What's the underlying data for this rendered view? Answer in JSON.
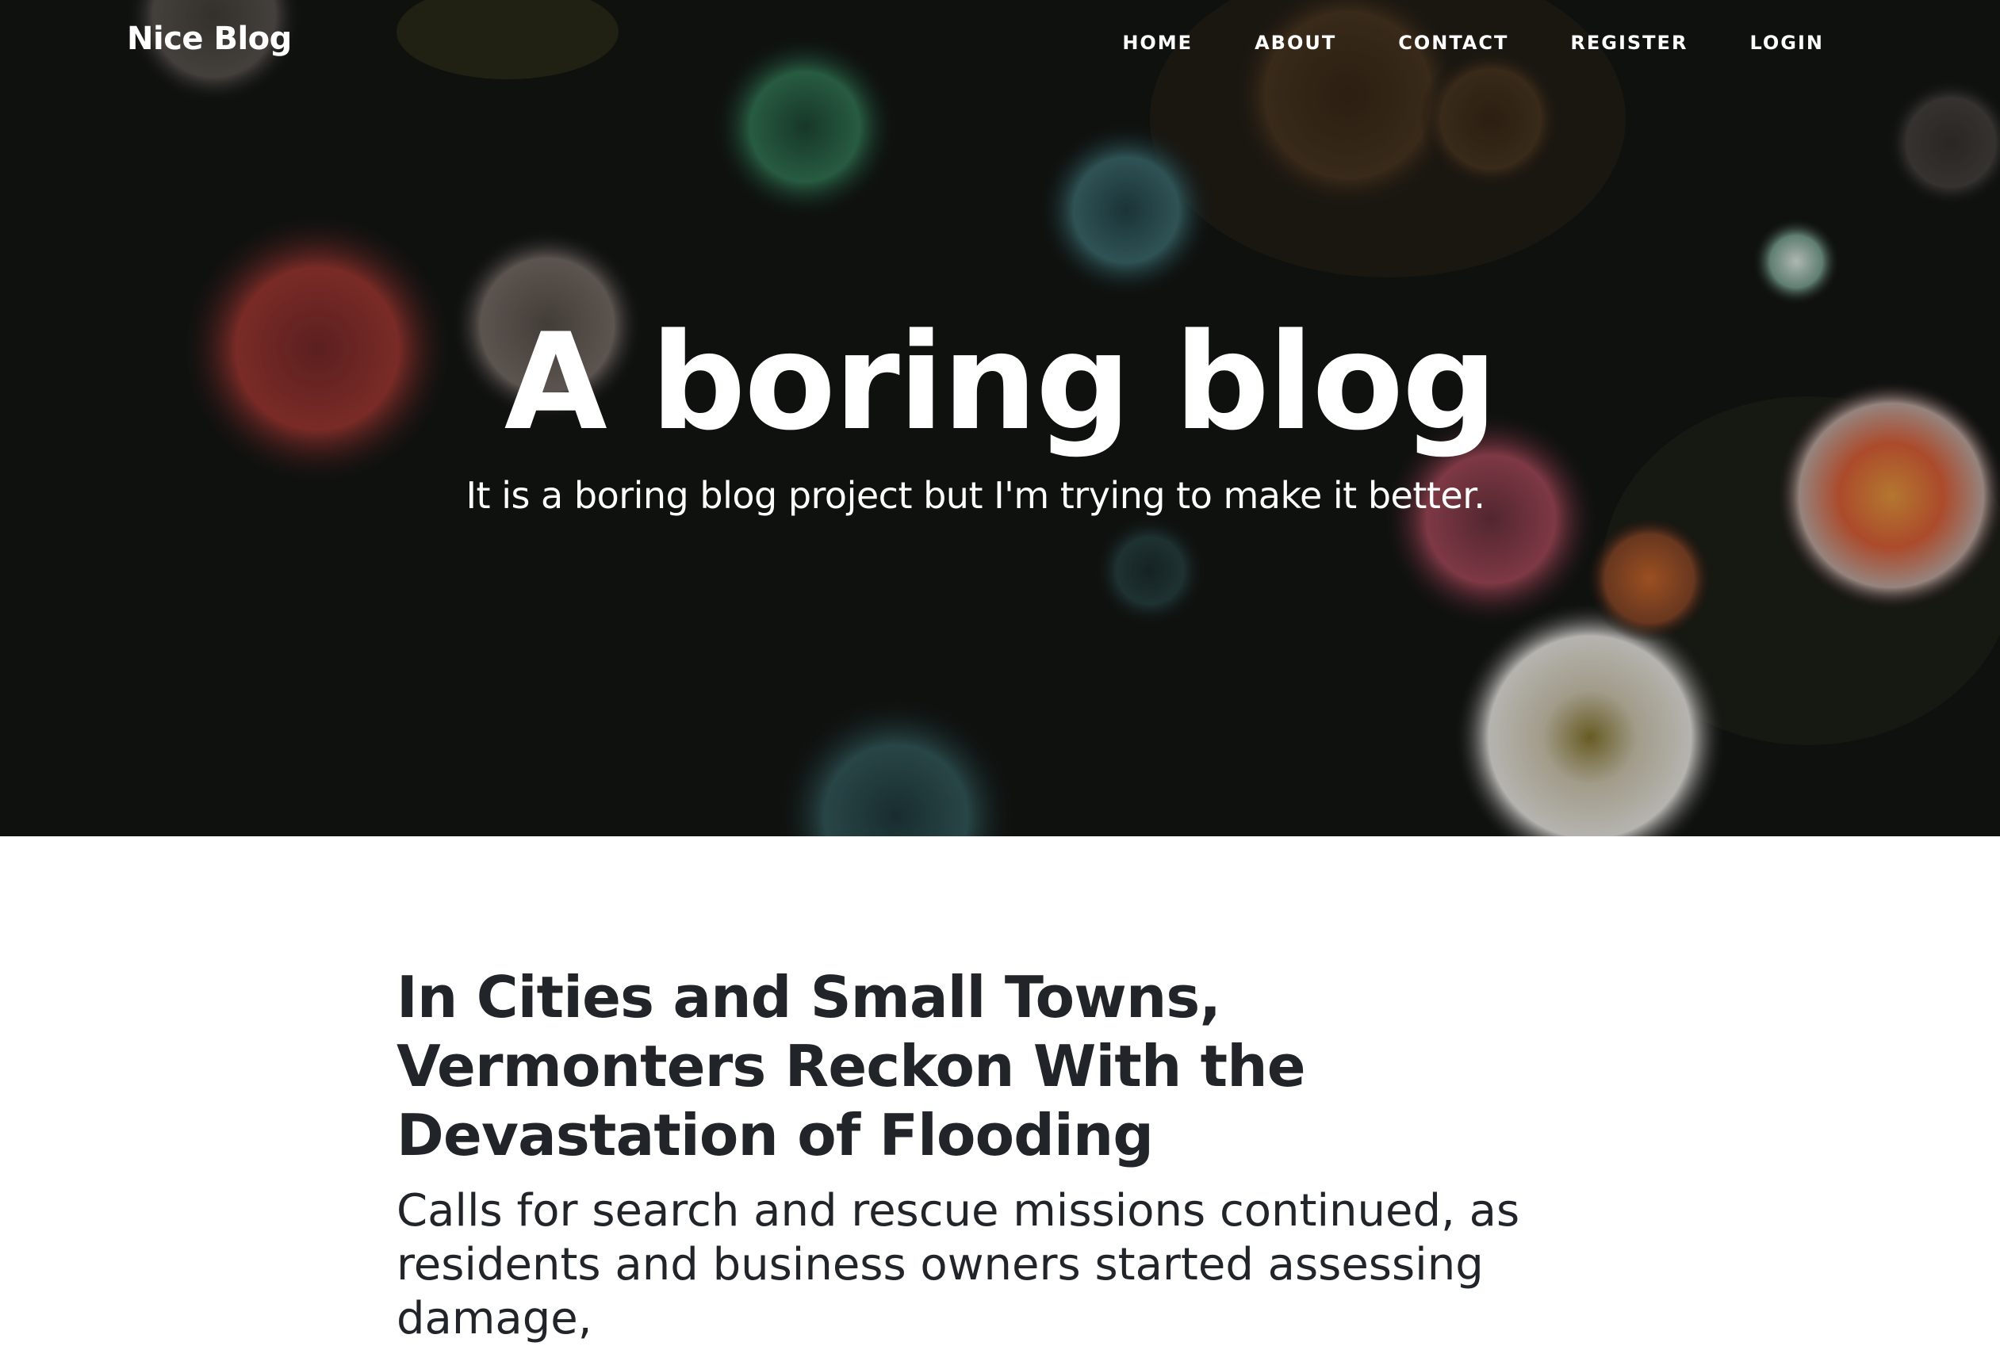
{
  "brand": "Nice Blog",
  "nav": {
    "items": [
      {
        "label": "HOME"
      },
      {
        "label": "ABOUT"
      },
      {
        "label": "CONTACT"
      },
      {
        "label": "REGISTER"
      },
      {
        "label": "LOGIN"
      }
    ]
  },
  "hero": {
    "title": "A boring blog",
    "subtitle": "It is a boring blog project but I'm trying to make it better."
  },
  "posts": [
    {
      "title": "In Cities and Small Towns, Vermonters Reckon With the Devastation of Flooding",
      "subtitle": "Calls for search and rescue missions continued, as residents and business owners started assessing damage,"
    }
  ],
  "colors": {
    "hero_overlay": "#151815",
    "text_dark": "#212529",
    "text_light": "#ffffff"
  }
}
